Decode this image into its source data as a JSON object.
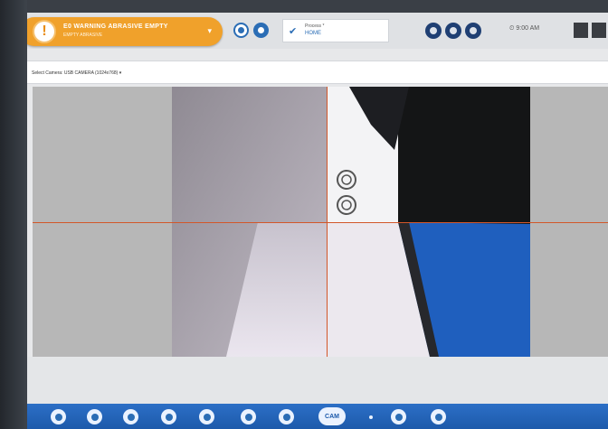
{
  "alert": {
    "icon": "exclamation-icon",
    "title": "E0 WARNING ABRASIVE EMPTY",
    "subtitle": "EMPTY ABRASIVE"
  },
  "process": {
    "label": "Process *",
    "value": "HOME"
  },
  "clock": {
    "time": "9:00 AM"
  },
  "camera": {
    "select_label": "Select Camera: USB CAMERA (1024x768) ▾"
  },
  "dock": {
    "cam_label": "CAM",
    "icons": [
      "globe-icon",
      "user-icon",
      "alert-icon",
      "wrench-icon",
      "gears-icon",
      "person-icon",
      "monitor-icon",
      "camera-icon",
      "dot-icon",
      "card-icon",
      "sound-icon"
    ]
  },
  "colors": {
    "accent": "#2b6db5",
    "warning": "#f0a12b",
    "crosshair": "#d2572a",
    "dock": "#1d5aab"
  }
}
